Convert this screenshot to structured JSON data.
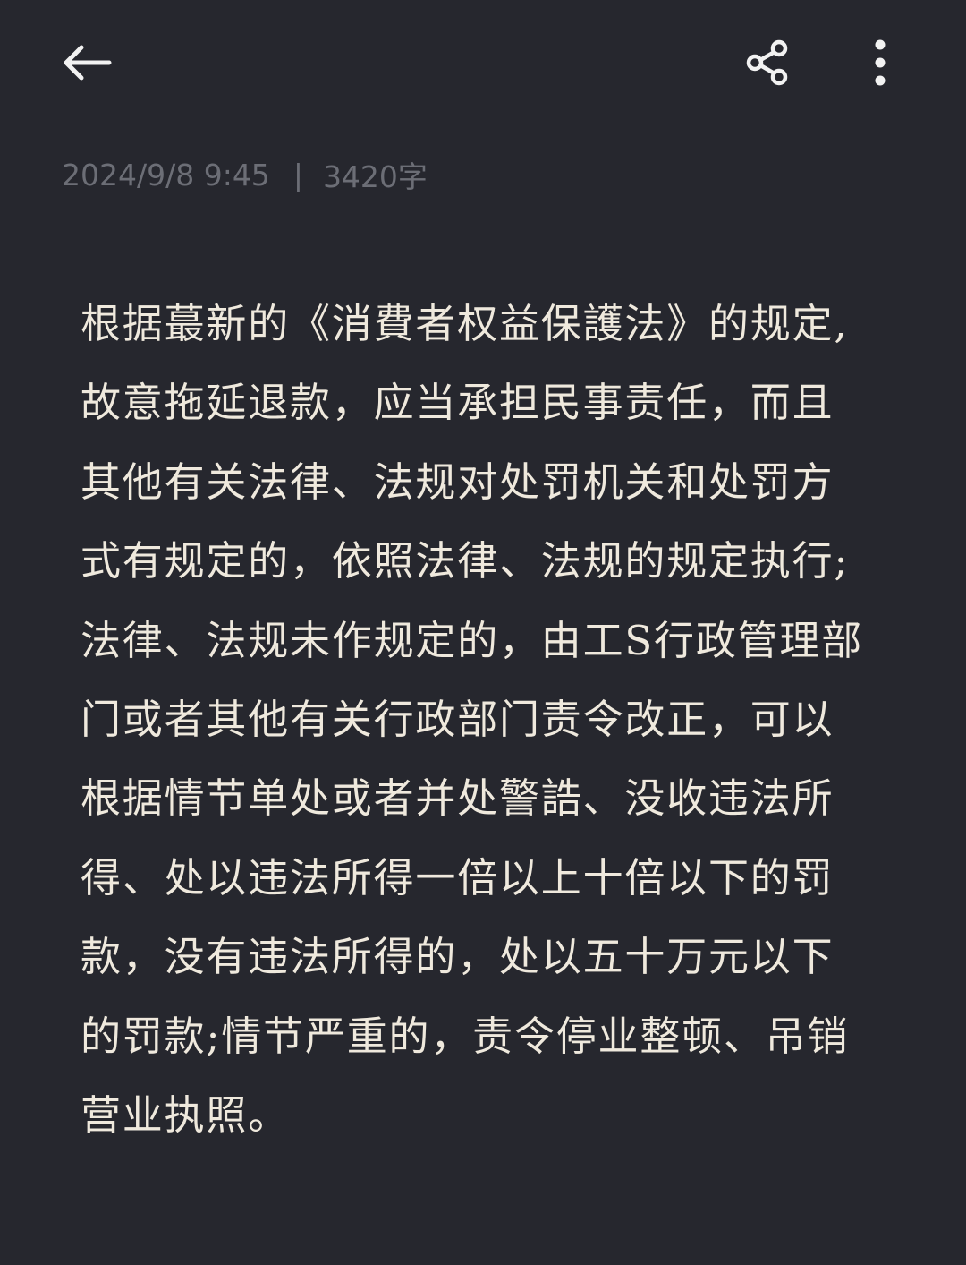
{
  "header": {
    "back_icon": "arrow-left-icon",
    "share_icon": "share-icon",
    "more_icon": "more-vertical-icon"
  },
  "meta": {
    "datetime": "2024/9/8 9:45",
    "separator": "|",
    "word_count": "3420字"
  },
  "note": {
    "lines": [
      "根据蕞新的《消費者权益保護法》的规定,",
      "故意拖延退款，应当承担民事责任，而且",
      "其他有关法律、法规对处罚机关和处罚方",
      "式有规定的，依照法律、法规的规定执行;",
      "法律、法规未作规定的，由工S行政管理部",
      "门或者其他有关行政部门责令改正，可以",
      "根据情节单处或者并处警誥、没收违法所",
      "得、处以违法所得一倍以上十倍以下的罚",
      "款，没有违法所得的，处以五十万元以下",
      "的罚款;情节严重的，责令停业整顿、吊销",
      "营业执照。"
    ]
  },
  "colors": {
    "background": "#26272e",
    "text": "#efe9dd",
    "meta_text": "#6c6e76",
    "icon": "#f2f2f2"
  }
}
